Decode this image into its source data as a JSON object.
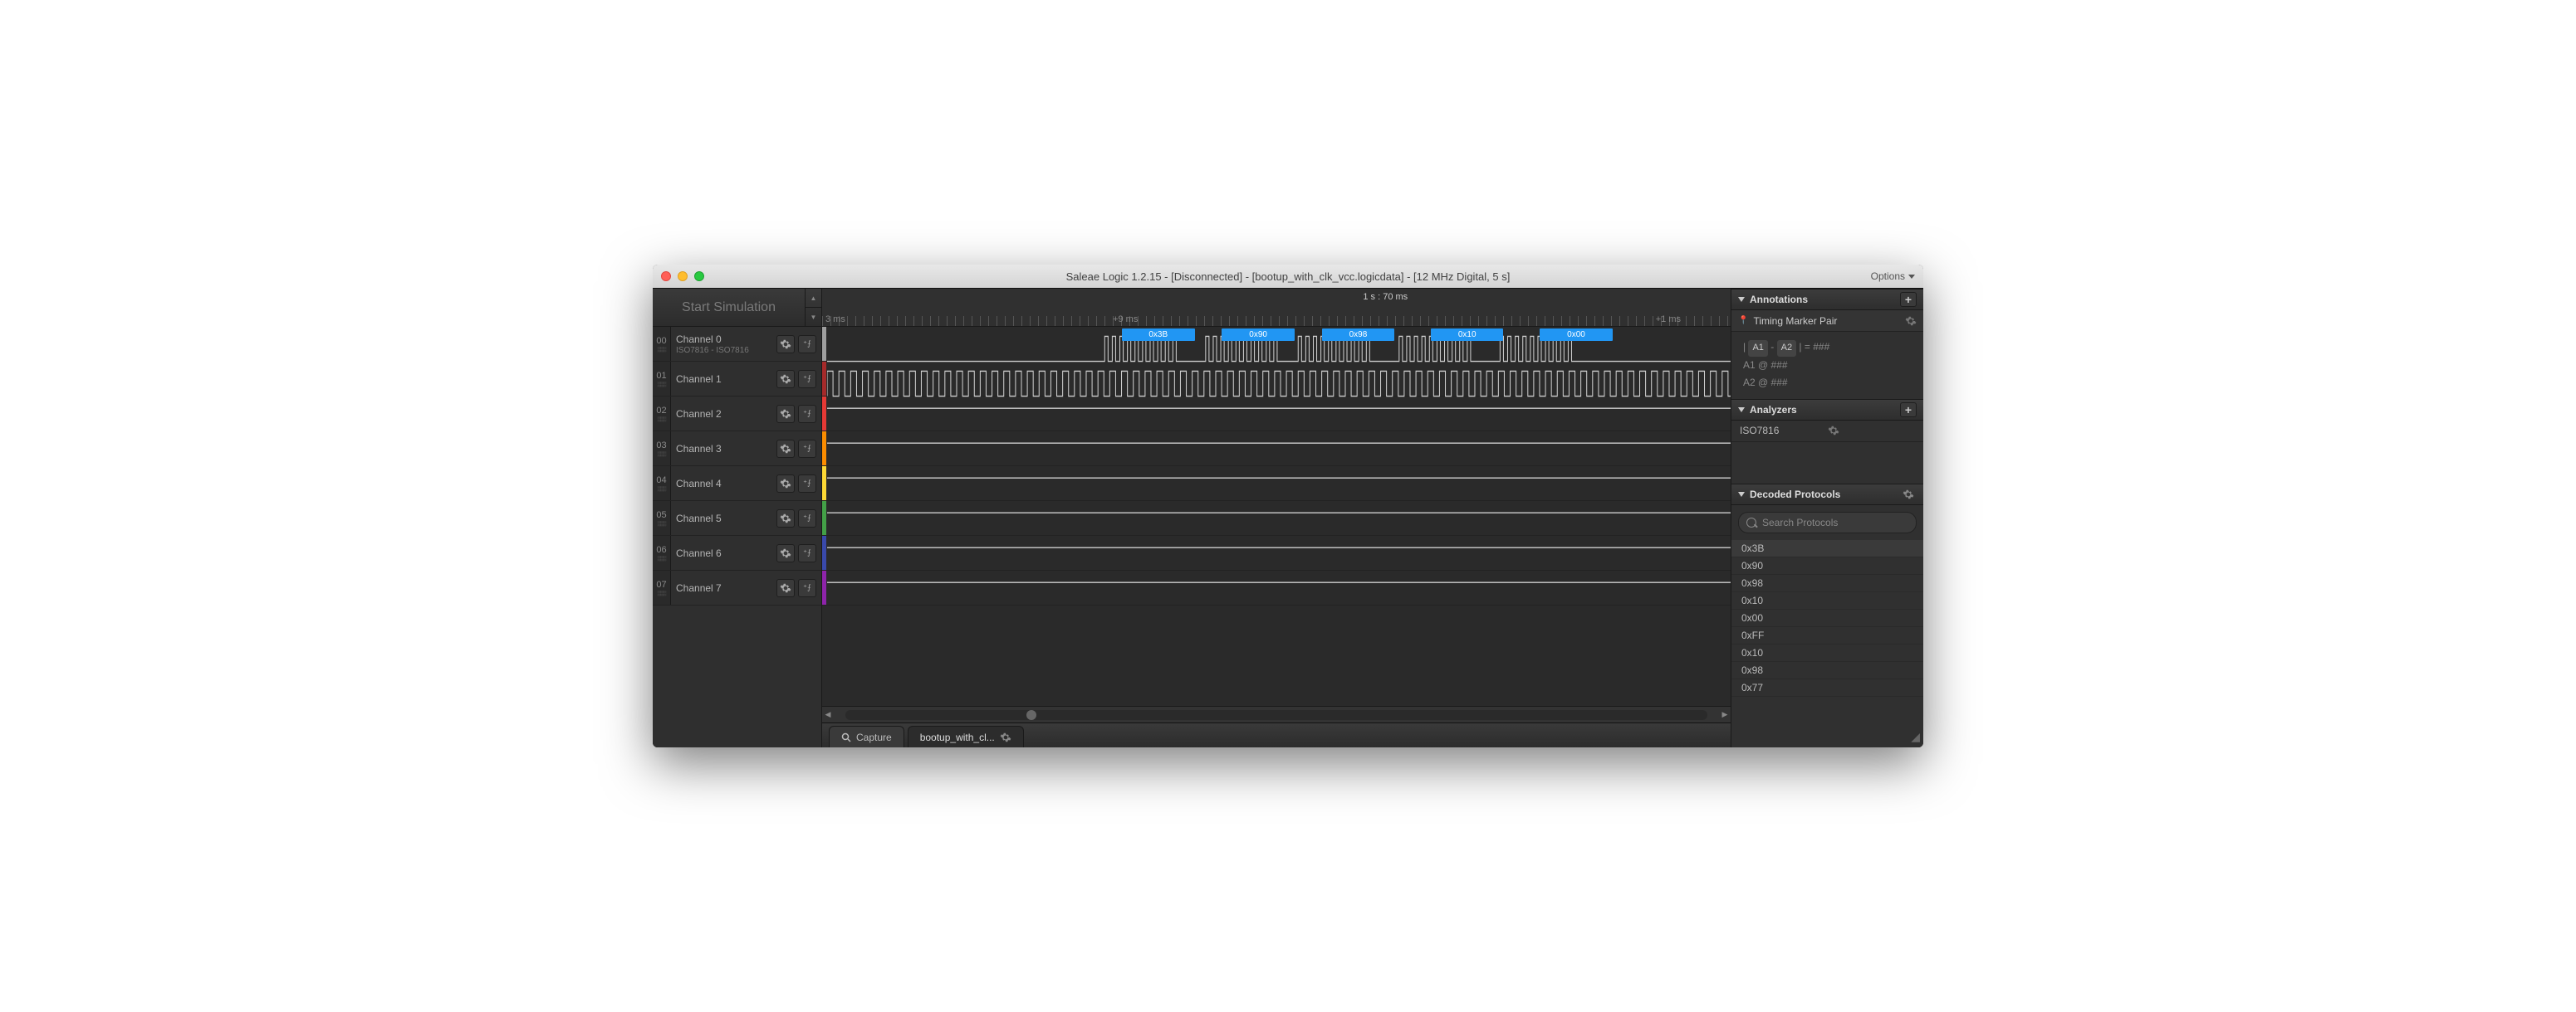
{
  "titlebar": {
    "title": "Saleae Logic 1.2.15 - [Disconnected] - [bootup_with_clk_vcc.logicdata] - [12 MHz Digital, 5 s]",
    "options_label": "Options"
  },
  "start_simulation_label": "Start Simulation",
  "ruler": {
    "cursor_position": "1 s : 70 ms",
    "tick_left": "3 ms",
    "tick_mid": "+9 ms",
    "tick_right": "+1 ms"
  },
  "channels": [
    {
      "num": "00",
      "label": "Channel 0",
      "sub": "ISO7816 - ISO7816",
      "color": "#9e9e9e"
    },
    {
      "num": "01",
      "label": "Channel 1",
      "sub": "",
      "color": "#a52a2a"
    },
    {
      "num": "02",
      "label": "Channel 2",
      "sub": "",
      "color": "#e53935"
    },
    {
      "num": "03",
      "label": "Channel 3",
      "sub": "",
      "color": "#fb8c00"
    },
    {
      "num": "04",
      "label": "Channel 4",
      "sub": "",
      "color": "#fdd835"
    },
    {
      "num": "05",
      "label": "Channel 5",
      "sub": "",
      "color": "#43a047"
    },
    {
      "num": "06",
      "label": "Channel 6",
      "sub": "",
      "color": "#3949ab"
    },
    {
      "num": "07",
      "label": "Channel 7",
      "sub": "",
      "color": "#8e24aa"
    }
  ],
  "decoded_bytes_on_ch0": [
    "0x3B",
    "0x90",
    "0x98",
    "0x10",
    "0x00"
  ],
  "annotations": {
    "header": "Annotations",
    "timing_marker_label": "Timing Marker Pair",
    "line1_a1_badge": "A1",
    "line1_dash": "-",
    "line1_a2_badge": "A2",
    "line1_eq": "|  =  ###",
    "line2": "A1   @   ###",
    "line3": "A2   @   ###"
  },
  "analyzers": {
    "header": "Analyzers",
    "items": [
      "ISO7816"
    ]
  },
  "decoded_protocols": {
    "header": "Decoded Protocols",
    "search_placeholder": "Search Protocols",
    "items": [
      "0x3B",
      "0x90",
      "0x98",
      "0x10",
      "0x00",
      "0xFF",
      "0x10",
      "0x98",
      "0x77"
    ]
  },
  "tabs": {
    "capture": "Capture",
    "file": "bootup_with_cl..."
  }
}
